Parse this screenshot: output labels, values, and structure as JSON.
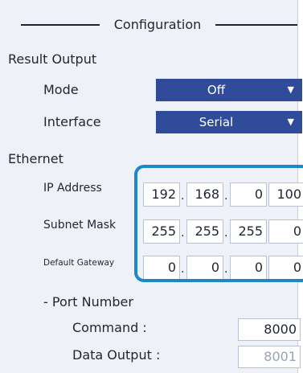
{
  "section_title": "Configuration",
  "result_output": {
    "header": "Result Output",
    "mode": {
      "label": "Mode",
      "value": "Off"
    },
    "interface": {
      "label": "Interface",
      "value": "Serial"
    }
  },
  "ethernet": {
    "header": "Ethernet",
    "ip_address": {
      "label": "IP Address",
      "octets": [
        "192",
        "168",
        "0",
        "100"
      ]
    },
    "subnet_mask": {
      "label": "Subnet Mask",
      "octets": [
        "255",
        "255",
        "255",
        "0"
      ]
    },
    "default_gateway": {
      "label": "Default Gateway",
      "octets": [
        "0",
        "0",
        "0",
        "0"
      ]
    },
    "port_number": {
      "header": "- Port Number",
      "command": {
        "label": "Command :",
        "value": "8000"
      },
      "data_output": {
        "label": "Data Output :",
        "value": "8001"
      }
    }
  },
  "colors": {
    "dropdown": "#2f4b99",
    "highlight": "#1f87c8",
    "panel_background": "#eef2f8"
  },
  "icons": {
    "dropdown_caret": "triangle-down-icon"
  }
}
